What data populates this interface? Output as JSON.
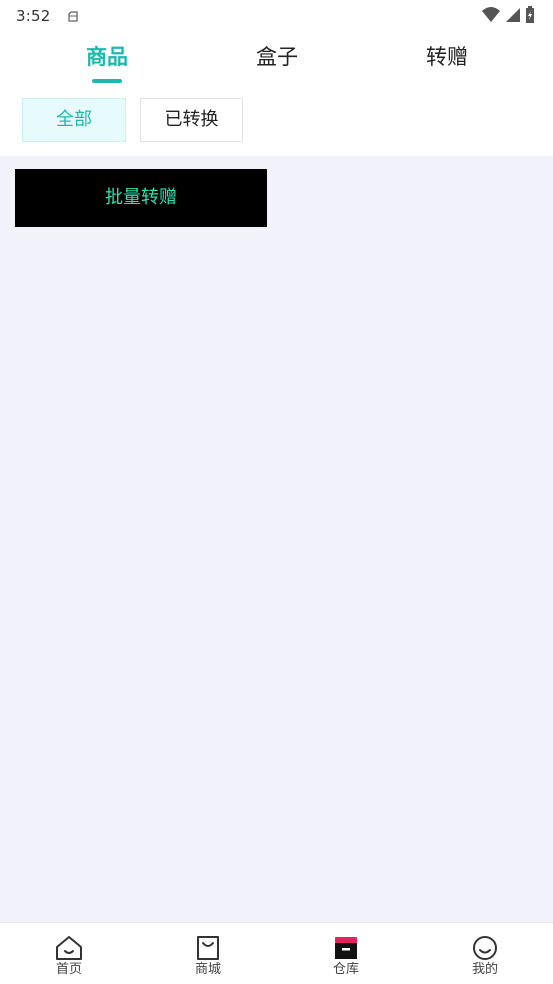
{
  "status_bar": {
    "time": "3:52"
  },
  "top_tabs": [
    {
      "label": "商品",
      "active": true
    },
    {
      "label": "盒子",
      "active": false
    },
    {
      "label": "转赠",
      "active": false
    }
  ],
  "filters": [
    {
      "label": "全部",
      "active": true
    },
    {
      "label": "已转换",
      "active": false
    }
  ],
  "content": {
    "batch_button_label": "批量转赠"
  },
  "bottom_nav": [
    {
      "label": "首页",
      "icon": "home-icon",
      "active": false
    },
    {
      "label": "商城",
      "icon": "shopping-bag-icon",
      "active": false
    },
    {
      "label": "仓库",
      "icon": "warehouse-box-icon",
      "active": true
    },
    {
      "label": "我的",
      "icon": "smiley-profile-icon",
      "active": false
    }
  ],
  "colors": {
    "accent": "#1fb8ad",
    "batch_text": "#2fe0b0",
    "background": "#f2f2fb",
    "active_nav_accent": "#e0245e"
  }
}
